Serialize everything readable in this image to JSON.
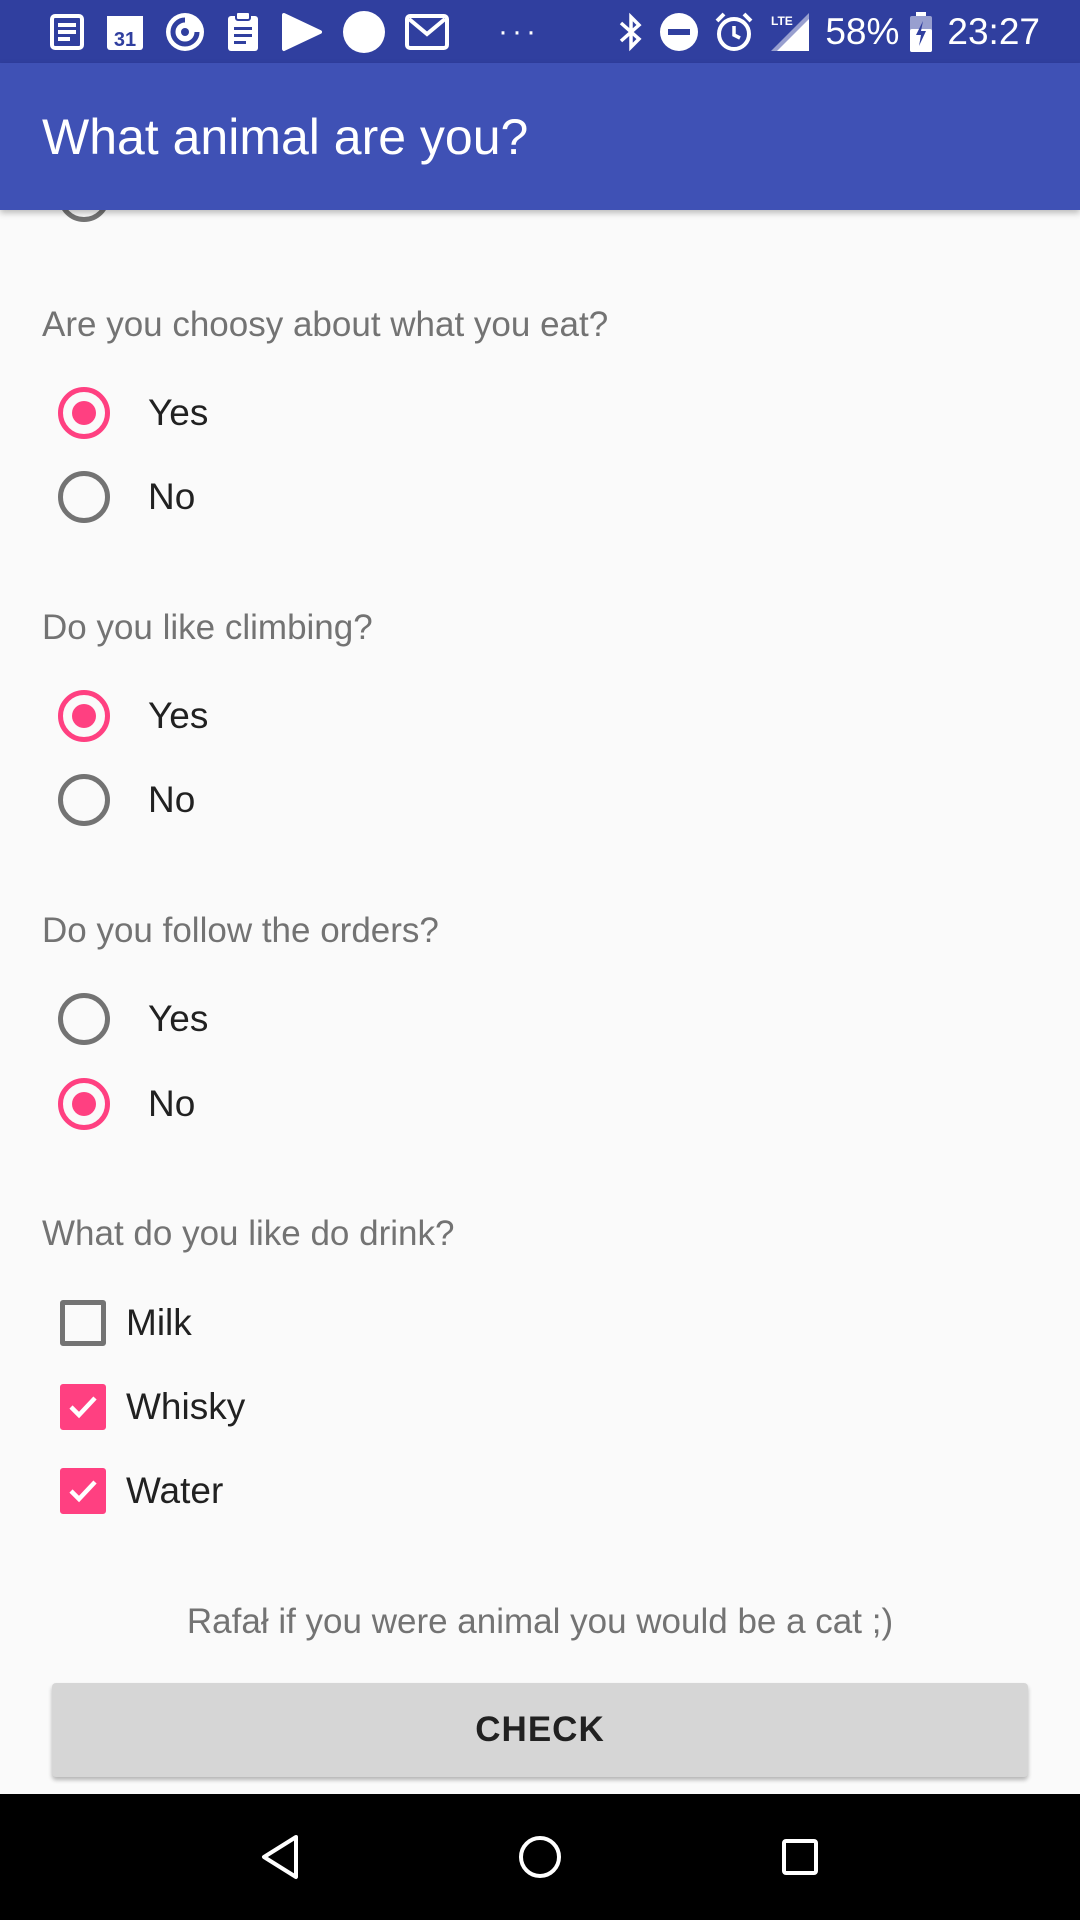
{
  "status_bar": {
    "calendar_day": "31",
    "dots": "···",
    "battery_percent": "58%",
    "time": "23:27",
    "network_label": "LTE"
  },
  "app_bar": {
    "title": "What animal are you?"
  },
  "questions": [
    {
      "text": "Are you choosy about what you eat?",
      "options": [
        "Yes",
        "No"
      ],
      "selected": "Yes"
    },
    {
      "text": "Do you like climbing?",
      "options": [
        "Yes",
        "No"
      ],
      "selected": "Yes"
    },
    {
      "text": "Do you follow the orders?",
      "options": [
        "Yes",
        "No"
      ],
      "selected": "No"
    }
  ],
  "drink_question": {
    "text": "What do you like do drink?",
    "options": [
      {
        "label": "Milk",
        "checked": false
      },
      {
        "label": "Whisky",
        "checked": true
      },
      {
        "label": "Water",
        "checked": true
      }
    ]
  },
  "result_text": "Rafał if you were animal you would be a cat ;)",
  "check_button_label": "CHECK",
  "colors": {
    "status_bar": "#303f9f",
    "app_bar": "#3f51b5",
    "accent": "#ff4081",
    "background": "#fafafa"
  }
}
